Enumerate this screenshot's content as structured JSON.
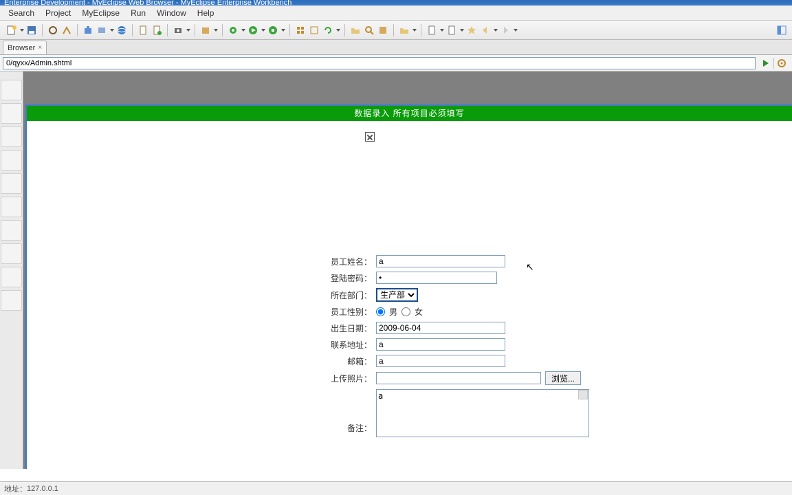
{
  "window": {
    "title": "Enterprise Development - MyEclipse Web Browser - MyEclipse Enterprise Workbench"
  },
  "menubar": [
    "Search",
    "Project",
    "MyEclipse",
    "Run",
    "Window",
    "Help"
  ],
  "tab": {
    "label": "Browser",
    "close": "×"
  },
  "addressbar": {
    "url": "0/qyxx/Admin.shtml"
  },
  "page": {
    "banner": "数据录入 所有项目必须填写",
    "labels": {
      "name": "员工姓名：",
      "password": "登陆密码：",
      "dept": "所在部门：",
      "gender": "员工性别：",
      "birth": "出生日期：",
      "address": "联系地址：",
      "email": "邮箱：",
      "photo": "上传照片：",
      "remark": "备注："
    },
    "values": {
      "name": "a",
      "password": "•",
      "dept_selected": "生产部",
      "male_label": "男",
      "female_label": "女",
      "birth": "2009-06-04",
      "address": "a",
      "email": "a",
      "photo": "",
      "browse": "浏览...",
      "remark": "a"
    },
    "dept_options": [
      "生产部"
    ]
  },
  "statusbar": {
    "addr_label": "地址：",
    "addr_value": "127.0.0.1"
  }
}
